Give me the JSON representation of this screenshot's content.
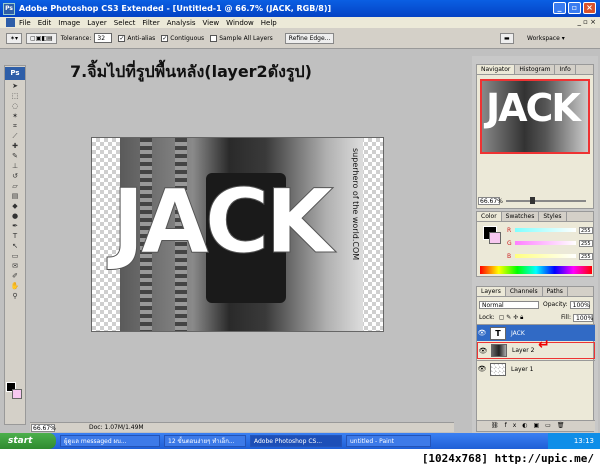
{
  "window": {
    "title": "Adobe Photoshop CS3 Extended - [Untitled-1 @ 66.7% (JACK, RGB/8)]",
    "ps_icon": "Ps"
  },
  "menu": [
    "File",
    "Edit",
    "Image",
    "Layer",
    "Select",
    "Filter",
    "Analysis",
    "View",
    "Window",
    "Help"
  ],
  "menu_right": "_ ▫ ×",
  "options": {
    "tolerance_label": "Tolerance:",
    "tolerance_value": "32",
    "antialias": "Anti-alias",
    "contiguous": "Contiguous",
    "sample_all": "Sample All Layers",
    "refine_edge": "Refine Edge...",
    "workspace": "Workspace ▾"
  },
  "caption": "7.จิ้มไปที่รูปพื้นหลัง(layer2ดังรูป)",
  "canvas": {
    "jack": "JACK",
    "watermark": "superhero of the world.COM"
  },
  "status": {
    "zoom": "66.67%",
    "doc": "Doc: 1.07M/1.49M"
  },
  "navigator": {
    "tabs": [
      "Navigator",
      "Histogram",
      "Info"
    ],
    "zoom": "66.67%",
    "jack": "JACK"
  },
  "color_panel": {
    "tabs": [
      "Color",
      "Swatches",
      "Styles"
    ],
    "r": "255",
    "g": "255",
    "b": "255",
    "r_label": "R",
    "g_label": "G",
    "b_label": "B"
  },
  "layers_panel": {
    "tabs": [
      "Layers",
      "Channels",
      "Paths"
    ],
    "blend": "Normal",
    "opacity_label": "Opacity:",
    "opacity": "100%",
    "lock_label": "Lock:",
    "fill_label": "Fill:",
    "fill": "100%",
    "layers": [
      {
        "name": "JACK",
        "thumb": "T",
        "active": true
      },
      {
        "name": "Layer 2",
        "thumb": "",
        "active": false
      },
      {
        "name": "Layer 1",
        "thumb": "",
        "active": false
      }
    ]
  },
  "taskbar": {
    "start": "start",
    "tasks": [
      "ผู้ดูแล messaged ผบ...",
      "12 ขั้นตอนง่ายๆ ทำเอ็ก...",
      "Adobe Photoshop CS...",
      "untitled - Paint"
    ],
    "clock": "13:13"
  },
  "footer": "[1024x768] http://upic.me/",
  "colors": {
    "accent": "#316ac5",
    "highlight": "#e33333",
    "title": "#0a5fe3"
  }
}
